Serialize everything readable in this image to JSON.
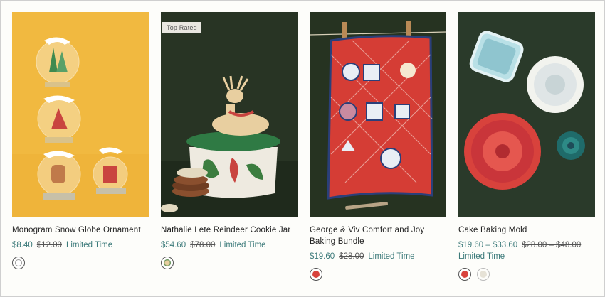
{
  "products": [
    {
      "name": "Monogram Snow Globe Ornament",
      "price": "$8.40",
      "was": "$12.00",
      "flag": "Limited Time",
      "swatches": [
        "white-swatch"
      ]
    },
    {
      "badge": "Top Rated",
      "name": "Nathalie Lete Reindeer Cookie Jar",
      "price": "$54.60",
      "was": "$78.00",
      "flag": "Limited Time",
      "swatches": [
        "reindeer-swatch"
      ]
    },
    {
      "name": "George & Viv Comfort and Joy Baking Bundle",
      "price": "$19.60",
      "was": "$28.00",
      "flag": "Limited Time",
      "swatches": [
        "red-swatch"
      ]
    },
    {
      "name": "Cake Baking Mold",
      "price": "$19.60 – $33.60",
      "was": "$28.00 – $48.00",
      "flag": "Limited Time",
      "swatches": [
        "red-swatch",
        "cream-swatch"
      ]
    }
  ],
  "colors": {
    "price": "#3c7a7a",
    "yellow_bg": "#f0b83c",
    "green_bg": "#2c3a28",
    "red": "#d8423c"
  }
}
